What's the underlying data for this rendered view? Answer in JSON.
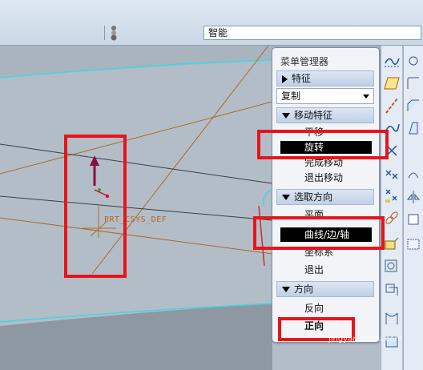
{
  "toolbar": {
    "filter_value": "智能"
  },
  "graphics": {
    "csys_label": "PRT_CSYS_DEF"
  },
  "menu_manager": {
    "title": "菜单管理器",
    "feature_header": "特征",
    "copy_dropdown": "复制",
    "move_feature_header": "移动特征",
    "move_items": [
      {
        "label": "平移",
        "selected": false
      },
      {
        "label": "旋转",
        "selected": true
      },
      {
        "label": "完成移动",
        "selected": false
      },
      {
        "label": "退出移动",
        "selected": false
      }
    ],
    "select_direction_header": "选取方向",
    "direction_items": [
      {
        "label": "平面",
        "selected": false
      },
      {
        "label": "曲线/边/轴",
        "selected": true
      },
      {
        "label": "坐标系",
        "selected": false
      },
      {
        "label": "退出",
        "selected": false
      }
    ],
    "direction_header": "方向",
    "orientation_items": [
      {
        "label": "反向",
        "selected": false
      },
      {
        "label": "正向",
        "selected": false
      }
    ]
  },
  "colors": {
    "highlight": "#e8141b",
    "selected_bg": "#000000",
    "section_header": "#c9d8ec"
  },
  "watermark": "jingyan.baidu.com"
}
